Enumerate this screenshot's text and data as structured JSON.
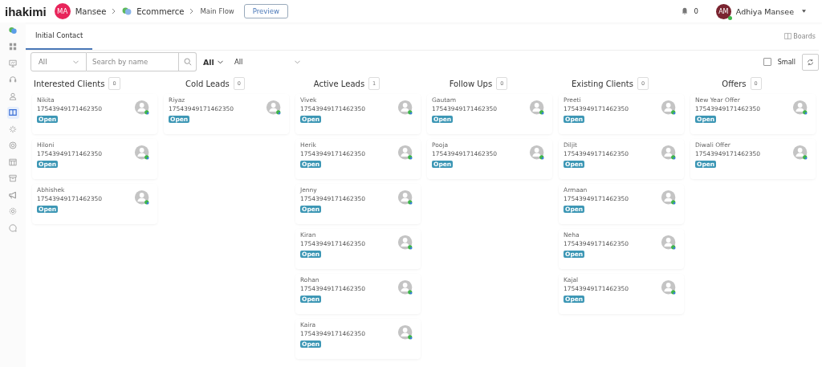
{
  "header": {
    "logo": "ihakimi",
    "workspace_initials": "MA",
    "workspace": "Mansee",
    "breadcrumb": [
      "Ecommerce",
      "Main Flow"
    ],
    "preview_button": "Preview",
    "notifications": "0",
    "user_initials": "AM",
    "user_name": "Adhiya Mansee"
  },
  "sidebar": [
    {
      "kind": "chat-color",
      "selected": false
    },
    {
      "kind": "grid",
      "selected": false
    },
    {
      "kind": "monitor",
      "selected": false
    },
    {
      "kind": "headset",
      "selected": false
    },
    {
      "kind": "user",
      "selected": false
    },
    {
      "kind": "columns",
      "selected": true
    },
    {
      "kind": "sparkle",
      "selected": false
    },
    {
      "kind": "lifebuoy",
      "selected": false
    },
    {
      "kind": "table",
      "selected": false
    },
    {
      "kind": "archive",
      "selected": false
    },
    {
      "kind": "megaphone",
      "selected": false
    },
    {
      "kind": "gear",
      "selected": false
    },
    {
      "kind": "chat",
      "selected": false
    }
  ],
  "tabs": [
    {
      "label": "Initial Contact",
      "selected": true
    }
  ],
  "boards_link": "Boards",
  "filters": {
    "type": "All",
    "search_placeholder": "Search by name",
    "owner": "All",
    "status": "All",
    "small_label": "Small",
    "small_checked": false
  },
  "columns": [
    {
      "title": "Interested Clients",
      "count": "0",
      "cards": [
        {
          "name": "Nikita",
          "id": "17543949171462350",
          "status": "Open"
        },
        {
          "name": "Hiloni",
          "id": "17543949171462350",
          "status": "Open"
        },
        {
          "name": "Abhishek",
          "id": "17543949171462350",
          "status": "Open"
        }
      ]
    },
    {
      "title": "Cold Leads",
      "count": "0",
      "cards": [
        {
          "name": "Riyaz",
          "id": "17543949171462350",
          "status": "Open"
        }
      ]
    },
    {
      "title": "Active Leads",
      "count": "1",
      "cards": [
        {
          "name": "Vivek",
          "id": "17543949171462350",
          "status": "Open"
        },
        {
          "name": "Herik",
          "id": "17543949171462350",
          "status": "Open"
        },
        {
          "name": "Jenny",
          "id": "17543949171462350",
          "status": "Open"
        },
        {
          "name": "Kiran",
          "id": "17543949171462350",
          "status": "Open"
        },
        {
          "name": "Rohan",
          "id": "17543949171462350",
          "status": "Open"
        },
        {
          "name": "Kaira",
          "id": "17543949171462350",
          "status": "Open"
        }
      ]
    },
    {
      "title": "Follow Ups",
      "count": "0",
      "cards": [
        {
          "name": "Gautam",
          "id": "17543949171462350",
          "status": "Open"
        },
        {
          "name": "Pooja",
          "id": "17543949171462350",
          "status": "Open"
        }
      ]
    },
    {
      "title": "Existing Clients",
      "count": "0",
      "cards": [
        {
          "name": "Preeti",
          "id": "17543949171462350",
          "status": "Open"
        },
        {
          "name": "Diljit",
          "id": "17543949171462350",
          "status": "Open"
        },
        {
          "name": "Armaan",
          "id": "17543949171462350",
          "status": "Open"
        },
        {
          "name": "Neha",
          "id": "17543949171462350",
          "status": "Open"
        },
        {
          "name": "Kajal",
          "id": "17543949171462350",
          "status": "Open"
        }
      ]
    },
    {
      "title": "Offers",
      "count": "0",
      "cards": [
        {
          "name": "New Year Offer",
          "id": "17543949171462350",
          "status": "Open"
        },
        {
          "name": "Diwali Offer",
          "id": "17543949171462350",
          "status": "Open"
        }
      ]
    }
  ]
}
